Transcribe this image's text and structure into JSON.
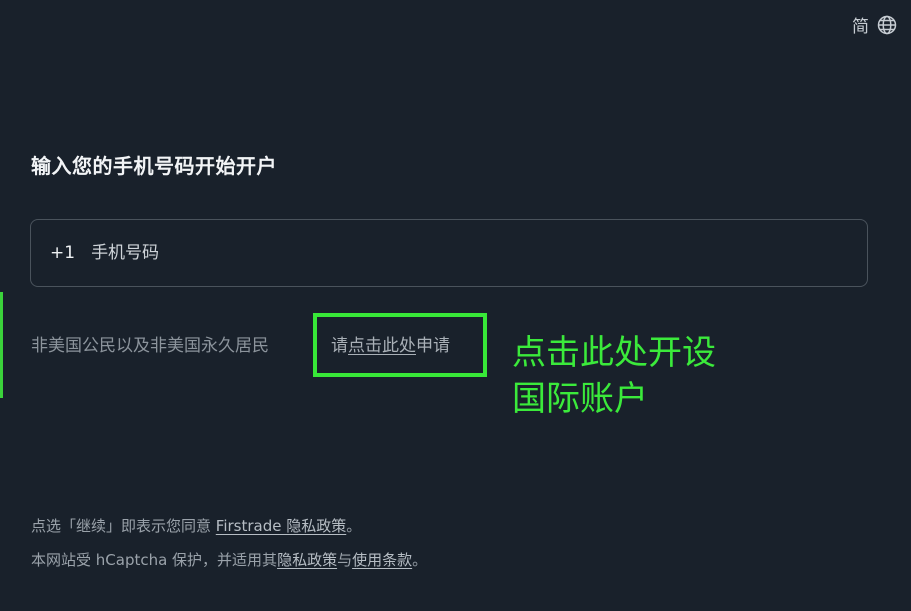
{
  "header": {
    "language_label": "简",
    "globe_icon": "globe-icon"
  },
  "signup": {
    "title": "输入您的手机号码开始开户",
    "country_code": "+1",
    "phone_placeholder": "手机号码"
  },
  "non_us": {
    "prefix": "非美国公民以及非美国永久居民",
    "apply_pre": "请",
    "apply_link": "点击此处",
    "apply_post": "申请"
  },
  "callout": {
    "line1": "点击此处开设",
    "line2": "国际账户"
  },
  "legal": {
    "line1_text": "点选「继续」即表示您同意 ",
    "line1_link": "Firstrade 隐私政策",
    "line1_end": "。",
    "line2_text": "本网站受 hCaptcha 保护，并适用其",
    "line2_link1": "隐私政策",
    "line2_mid": "与",
    "line2_link2": "使用条款",
    "line2_end": "。"
  },
  "colors": {
    "background": "#19212b",
    "highlight": "#38e838"
  }
}
